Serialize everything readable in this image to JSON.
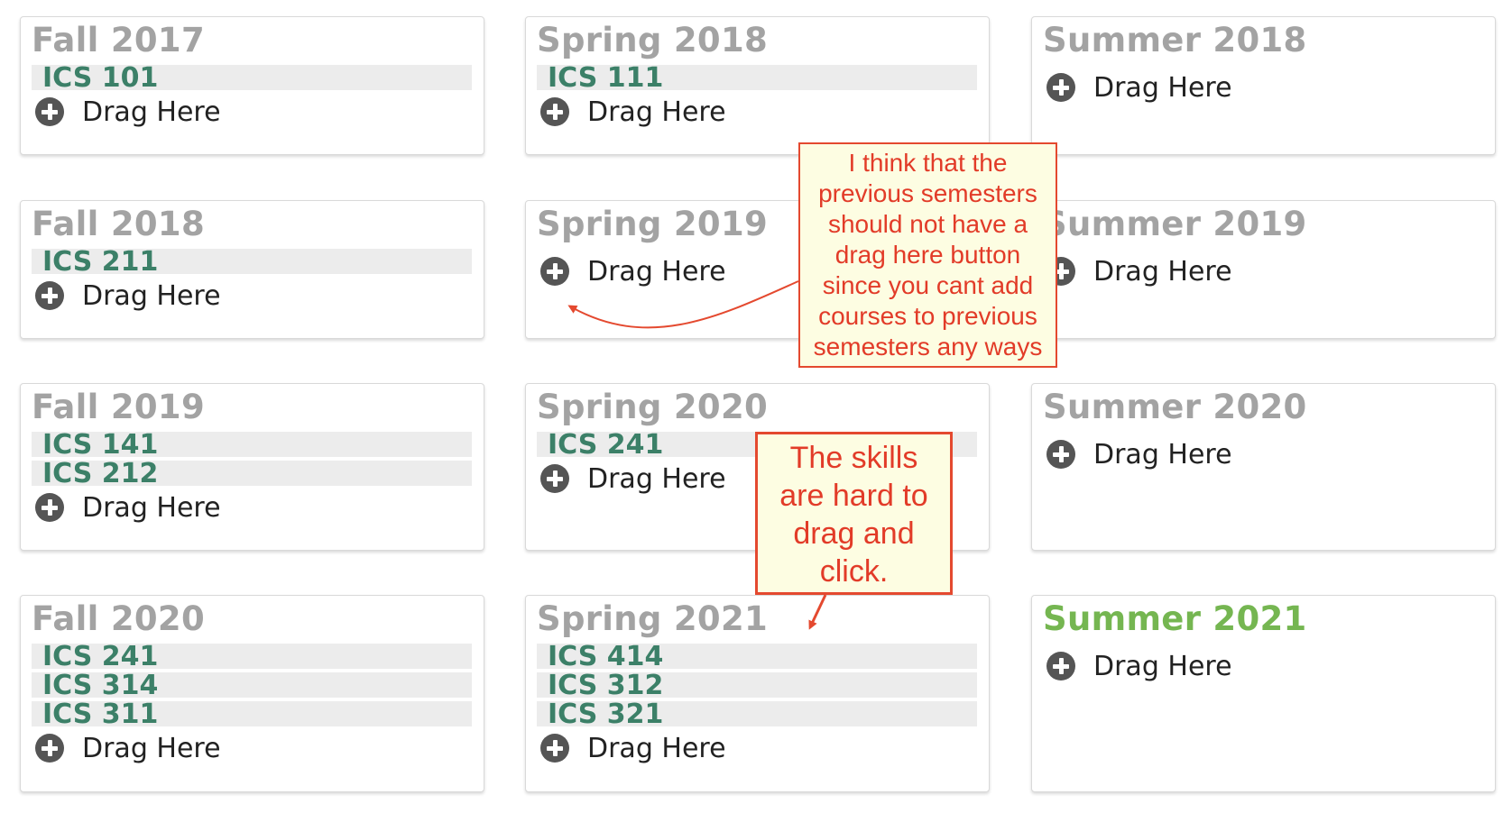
{
  "drag_label": "Drag Here",
  "semesters": [
    {
      "name": "Fall 2017",
      "courses": [
        "ICS 101"
      ]
    },
    {
      "name": "Spring 2018",
      "courses": [
        "ICS 111"
      ]
    },
    {
      "name": "Summer 2018",
      "courses": []
    },
    {
      "name": "Fall 2018",
      "courses": [
        "ICS 211"
      ]
    },
    {
      "name": "Spring 2019",
      "courses": []
    },
    {
      "name": "Summer 2019",
      "courses": []
    },
    {
      "name": "Fall 2019",
      "courses": [
        "ICS 141",
        "ICS 212"
      ]
    },
    {
      "name": "Spring 2020",
      "courses": [
        "ICS 241"
      ]
    },
    {
      "name": "Summer 2020",
      "courses": []
    },
    {
      "name": "Fall 2020",
      "courses": [
        "ICS 241",
        "ICS 314",
        "ICS 311"
      ]
    },
    {
      "name": "Spring 2021",
      "courses": [
        "ICS 414",
        "ICS 312",
        "ICS 321"
      ]
    },
    {
      "name": "Summer 2021",
      "courses": [],
      "current": true
    }
  ],
  "annotations": {
    "note1": [
      "I think that the",
      "previous semesters",
      "should not have a",
      "drag here button",
      "since you cant add",
      "courses to previous",
      "semesters any ways"
    ],
    "note2": [
      "The skills",
      "are hard to",
      "drag and",
      "click."
    ]
  },
  "colors": {
    "course_text": "#3c8068",
    "course_bg": "#ececec",
    "title_gray": "#a3a3a3",
    "title_current": "#75b651",
    "annotation_red": "#e23b28",
    "annotation_bg": "#fdfde2"
  }
}
